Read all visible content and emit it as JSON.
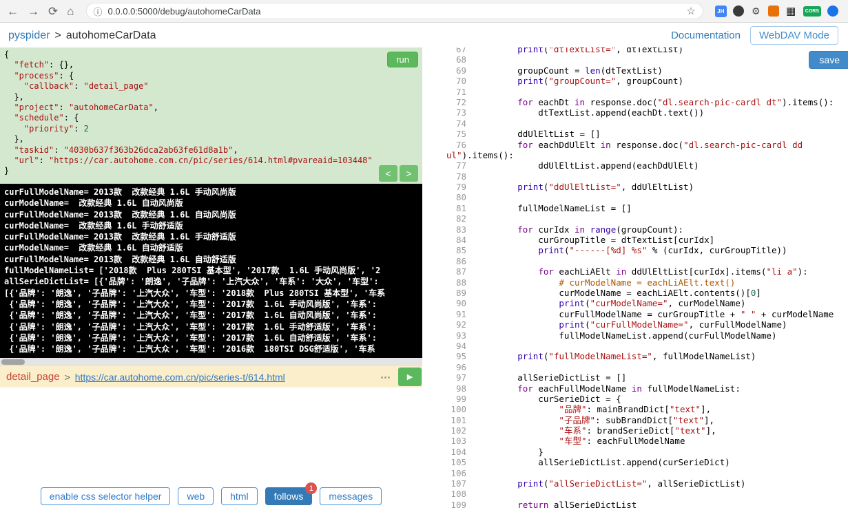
{
  "browser": {
    "nav_back": "←",
    "nav_forward": "→",
    "nav_reload": "⟳",
    "nav_home": "⌂",
    "info_icon": "ⓘ",
    "url": "0.0.0.0:5000/debug/autohomeCarData",
    "star_icon": "☆",
    "ext_jh": "JH",
    "ext_gear": "⚙",
    "ext_qr": "▦",
    "ext_cors": "CORS"
  },
  "header": {
    "brand": "pyspider",
    "separator": ">",
    "project": "autohomeCarData",
    "doc_link": "Documentation",
    "webdav_button": "WebDAV Mode"
  },
  "task_editor": {
    "run_label": "run",
    "prev_label": "<",
    "next_label": ">",
    "lines": [
      "{",
      "  \"fetch\": {},",
      "  \"process\": {",
      "    \"callback\": \"detail_page\"",
      "  },",
      "  \"project\": \"autohomeCarData\",",
      "  \"schedule\": {",
      "    \"priority\": 2",
      "  },",
      "  \"taskid\": \"4030b637f363b26dca2ab63fe61d8a1b\",",
      "  \"url\": \"https://car.autohome.com.cn/pic/series/614.html#pvareaid=103448\"",
      "}"
    ]
  },
  "console": {
    "lines": [
      "curFullModelName= 2013款  改款经典 1.6L 手动风尚版",
      "curModelName=  改款经典 1.6L 自动风尚版",
      "curFullModelName= 2013款  改款经典 1.6L 自动风尚版",
      "curModelName=  改款经典 1.6L 手动舒适版",
      "curFullModelName= 2013款  改款经典 1.6L 手动舒适版",
      "curModelName=  改款经典 1.6L 自动舒适版",
      "curFullModelName= 2013款  改款经典 1.6L 自动舒适版",
      "fullModelNameList= ['2018款  Plus 280TSI 基本型', '2017款  1.6L 手动风尚版', '2",
      "allSerieDictList= [{'品牌': '朗逸', '子品牌': '上汽大众', '车系': '大众', '车型':",
      "[{'品牌': '朗逸', '子品牌': '上汽大众', '车型': '2018款  Plus 280TSI 基本型', '车系",
      " {'品牌': '朗逸', '子品牌': '上汽大众', '车型': '2017款  1.6L 手动风尚版', '车系':",
      " {'品牌': '朗逸', '子品牌': '上汽大众', '车型': '2017款  1.6L 自动风尚版', '车系':",
      " {'品牌': '朗逸', '子品牌': '上汽大众', '车型': '2017款  1.6L 手动舒适版', '车系':",
      " {'品牌': '朗逸', '子品牌': '上汽大众', '车型': '2017款  1.6L 自动舒适版', '车系':",
      " {'品牌': '朗逸', '子品牌': '上汽大众', '车型': '2016款  180TSI DSG舒适版', '车系"
    ]
  },
  "follow": {
    "callback": "detail_page",
    "separator": ">",
    "url": "https://car.autohome.com.cn/pic/series-t/614.html",
    "more_label": "⋯",
    "play_icon": "▶"
  },
  "toolbar": {
    "buttons": [
      "enable css selector helper",
      "web",
      "html",
      "follows",
      "messages"
    ],
    "follows_badge": "1"
  },
  "code_editor": {
    "save_label": "save",
    "rows": [
      {
        "n": "67",
        "t": "        print(\"dtTextList=\", dtTextList)"
      },
      {
        "n": "68",
        "t": ""
      },
      {
        "n": "69",
        "t": "        groupCount = len(dtTextList)"
      },
      {
        "n": "70",
        "t": "        print(\"groupCount=\", groupCount)"
      },
      {
        "n": "71",
        "t": ""
      },
      {
        "n": "72",
        "t": "        for eachDt in response.doc(\"dl.search-pic-cardl dt\").items():"
      },
      {
        "n": "73",
        "t": "            dtTextList.append(eachDt.text())"
      },
      {
        "n": "74",
        "t": ""
      },
      {
        "n": "75",
        "t": "        ddUlEltList = []"
      },
      {
        "n": "76",
        "t": "        for eachDdUlElt in response.doc(\"dl.search-pic-cardl dd"
      },
      {
        "n": "",
        "t": "ul\").items():",
        "cont": true
      },
      {
        "n": "77",
        "t": "            ddUlEltList.append(eachDdUlElt)"
      },
      {
        "n": "78",
        "t": ""
      },
      {
        "n": "79",
        "t": "        print(\"ddUlEltList=\", ddUlEltList)"
      },
      {
        "n": "80",
        "t": ""
      },
      {
        "n": "81",
        "t": "        fullModelNameList = []"
      },
      {
        "n": "82",
        "t": ""
      },
      {
        "n": "83",
        "t": "        for curIdx in range(groupCount):"
      },
      {
        "n": "84",
        "t": "            curGroupTitle = dtTextList[curIdx]"
      },
      {
        "n": "85",
        "t": "            print(\"------[%d] %s\" % (curIdx, curGroupTitle))"
      },
      {
        "n": "86",
        "t": ""
      },
      {
        "n": "87",
        "t": "            for eachLiAElt in ddUlEltList[curIdx].items(\"li a\"):"
      },
      {
        "n": "88",
        "t": "                # curModelName = eachLiAElt.text()"
      },
      {
        "n": "89",
        "t": "                curModelName = eachLiAElt.contents()[0]"
      },
      {
        "n": "90",
        "t": "                print(\"curModelName=\", curModelName)"
      },
      {
        "n": "91",
        "t": "                curFullModelName = curGroupTitle + \" \" + curModelName"
      },
      {
        "n": "92",
        "t": "                print(\"curFullModelName=\", curFullModelName)"
      },
      {
        "n": "93",
        "t": "                fullModelNameList.append(curFullModelName)"
      },
      {
        "n": "94",
        "t": ""
      },
      {
        "n": "95",
        "t": "        print(\"fullModelNameList=\", fullModelNameList)"
      },
      {
        "n": "96",
        "t": ""
      },
      {
        "n": "97",
        "t": "        allSerieDictList = []"
      },
      {
        "n": "98",
        "t": "        for eachFullModelName in fullModelNameList:"
      },
      {
        "n": "99",
        "t": "            curSerieDict = {"
      },
      {
        "n": "100",
        "t": "                \"品牌\": mainBrandDict[\"text\"],"
      },
      {
        "n": "101",
        "t": "                \"子品牌\": subBrandDict[\"text\"],"
      },
      {
        "n": "102",
        "t": "                \"车系\": brandSerieDict[\"text\"],"
      },
      {
        "n": "103",
        "t": "                \"车型\": eachFullModelName"
      },
      {
        "n": "104",
        "t": "            }"
      },
      {
        "n": "105",
        "t": "            allSerieDictList.append(curSerieDict)"
      },
      {
        "n": "106",
        "t": ""
      },
      {
        "n": "107",
        "t": "        print(\"allSerieDictList=\", allSerieDictList)"
      },
      {
        "n": "108",
        "t": ""
      },
      {
        "n": "109",
        "t": "        return allSerieDictList"
      }
    ]
  },
  "colors": {
    "accent_blue": "#337ab7",
    "run_green": "#5cb85c",
    "badge_red": "#d9534f",
    "editor_green": "#d3e8cf",
    "follow_bg": "#fbeecb"
  }
}
